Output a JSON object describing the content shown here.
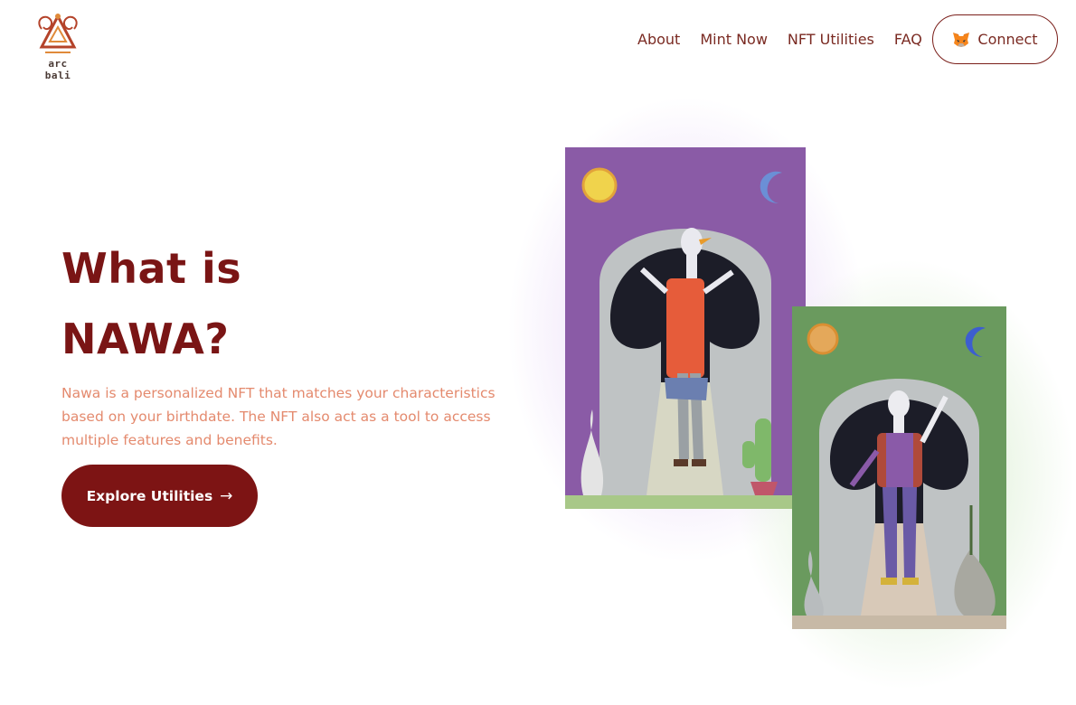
{
  "brand": {
    "name": "arc bali",
    "accent": "#7d1414",
    "text_color": "#7a2a22",
    "desc_color": "#e48a6e"
  },
  "nav": {
    "items": [
      {
        "label": "About"
      },
      {
        "label": "Mint Now"
      },
      {
        "label": "NFT Utilities"
      },
      {
        "label": "FAQ"
      }
    ],
    "connect_label": "Connect",
    "connect_icon": "metamask-fox-icon"
  },
  "hero": {
    "title_line1": "What is",
    "title_line2": "NAWA?",
    "description": "Nawa is a personalized NFT that matches your characteristics based on your birthdate. The NFT also act as a tool to access multiple features and benefits.",
    "cta_label": "Explore Utilities",
    "cta_icon": "arrow-right-icon"
  },
  "cards": [
    {
      "name": "nawa-card-purple",
      "background": "#8a5ba6",
      "icon": "goose-character-illustration"
    },
    {
      "name": "nawa-card-green",
      "background": "#6a9a5e",
      "icon": "goose-character-illustration"
    }
  ]
}
